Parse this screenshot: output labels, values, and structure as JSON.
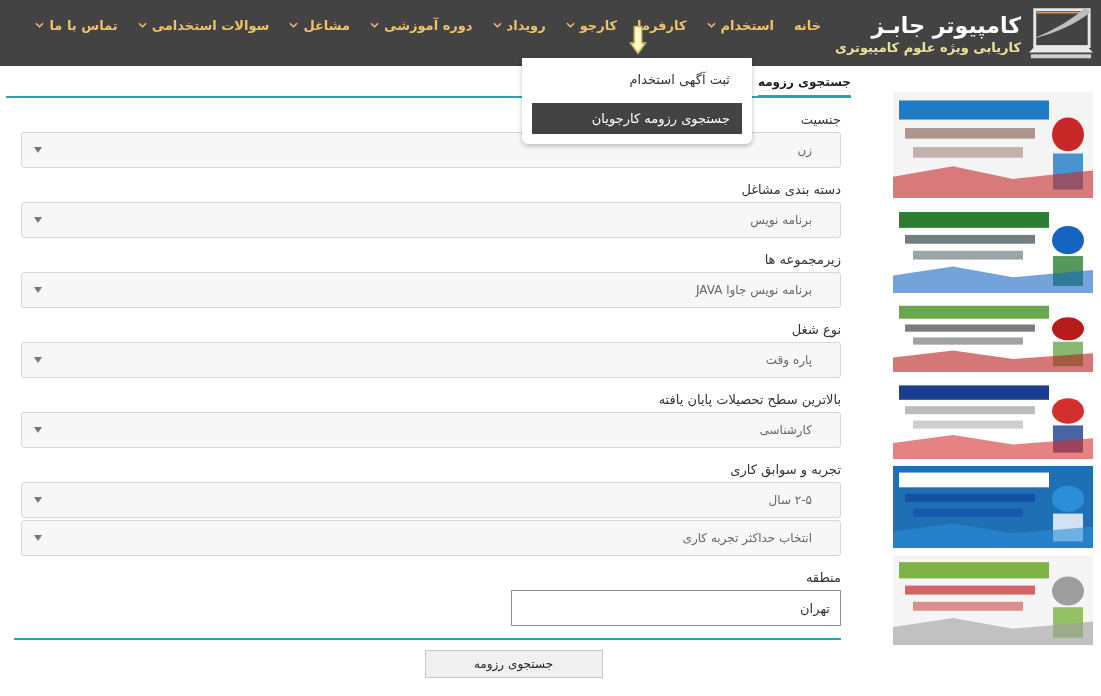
{
  "logo": {
    "title": "کامپیوتر جابـز",
    "tagline": "کاریابی ویژه علوم کامپیوتری"
  },
  "nav": [
    {
      "label": "خانه",
      "has_menu": false
    },
    {
      "label": "استخدام",
      "has_menu": true
    },
    {
      "label": "کارفرما",
      "has_menu": false
    },
    {
      "label": "کارجو",
      "has_menu": true
    },
    {
      "label": "رویداد",
      "has_menu": true
    },
    {
      "label": "دوره آموزشی",
      "has_menu": true
    },
    {
      "label": "مشاغل",
      "has_menu": true
    },
    {
      "label": "سوالات استخدامی",
      "has_menu": true
    },
    {
      "label": "تماس با ما",
      "has_menu": true
    }
  ],
  "dropdown": {
    "items": [
      {
        "label": "ثبت آگهی استخدام",
        "selected": false
      },
      {
        "label": "جستجوی رزومه کارجویان",
        "selected": true
      }
    ]
  },
  "form": {
    "title": "جستجوی رزومه",
    "fields": [
      {
        "label": "جنسیت",
        "kind": "select",
        "values": [
          "زن"
        ]
      },
      {
        "label": "دسته بندی مشاغل",
        "kind": "select",
        "values": [
          "برنامه نویس"
        ]
      },
      {
        "label": "زیرمجموعه ها",
        "kind": "select",
        "values": [
          "برنامه نویس جاوا JAVA"
        ]
      },
      {
        "label": "نوع شغل",
        "kind": "select",
        "values": [
          "پاره وقت"
        ]
      },
      {
        "label": "بالاترین سطح تحصیلات پایان یافته",
        "kind": "select",
        "values": [
          "کارشناسی"
        ]
      },
      {
        "label": "تجربه و سوابق کاری",
        "kind": "select",
        "values": [
          "۲-۵ سال",
          "انتخاب حداکثر تجربه کاری"
        ]
      },
      {
        "label": "منطقه",
        "kind": "text",
        "values": [
          "تهران"
        ]
      }
    ],
    "submit": "جستجوی رزومه"
  }
}
